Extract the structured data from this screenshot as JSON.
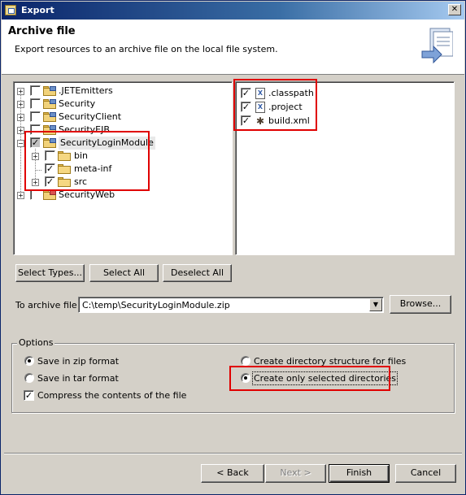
{
  "window": {
    "title": "Export",
    "close_glyph": "✕"
  },
  "banner": {
    "heading": "Archive file",
    "description": "Export resources to an archive file on the local file system.",
    "icon": "wizard-export-icon"
  },
  "tree": {
    "items": [
      {
        "label": ".JETEmitters",
        "checked": false,
        "expander": "+"
      },
      {
        "label": "Security",
        "checked": false,
        "expander": "+"
      },
      {
        "label": "SecurityClient",
        "checked": false,
        "expander": "+"
      },
      {
        "label": "SecurityEJB",
        "checked": false,
        "expander": "+"
      },
      {
        "label": "SecurityLoginModule",
        "checked": "partial",
        "expander": "−",
        "selected": true
      },
      {
        "label": "bin",
        "checked": false,
        "expander": "+"
      },
      {
        "label": "meta-inf",
        "checked": true,
        "expander": ""
      },
      {
        "label": "src",
        "checked": true,
        "expander": "+"
      },
      {
        "label": "SecurityWeb",
        "checked": false,
        "expander": "+"
      }
    ]
  },
  "files": {
    "items": [
      {
        "label": ".classpath",
        "checked": true,
        "icon": "xml-file-icon"
      },
      {
        "label": ".project",
        "checked": true,
        "icon": "xml-file-icon"
      },
      {
        "label": "build.xml",
        "checked": true,
        "icon": "ant-file-icon"
      }
    ]
  },
  "buttons": {
    "select_types": "Select Types...",
    "select_all": "Select All",
    "deselect_all": "Deselect All",
    "browse": "Browse...",
    "back": "< Back",
    "next": "Next >",
    "finish": "Finish",
    "cancel": "Cancel"
  },
  "archive": {
    "label": "To archive file:",
    "value": "C:\\temp\\SecurityLoginModule.zip",
    "dropdown_glyph": "▼"
  },
  "options": {
    "legend": "Options",
    "zip_label": "Save in zip format",
    "zip_selected": true,
    "tar_label": "Save in tar format",
    "tar_selected": false,
    "compress_label": "Compress the contents of the file",
    "compress_checked": true,
    "structure_label": "Create directory structure for files",
    "structure_selected": false,
    "selected_dirs_label": "Create only selected directories",
    "selected_dirs_selected": true
  },
  "colors": {
    "highlight": "#e00000",
    "titlebar": "#0a246a"
  }
}
